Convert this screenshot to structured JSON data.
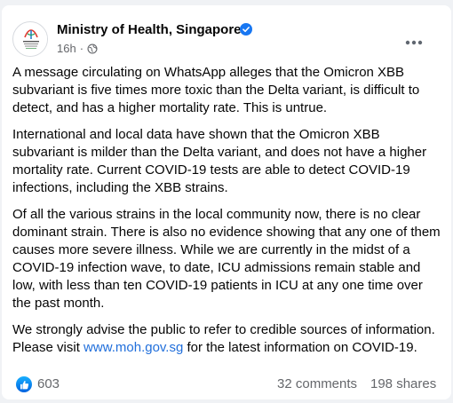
{
  "post": {
    "page_name": "Ministry of Health, Singapore",
    "time": "16h",
    "audience_icon": "globe-icon",
    "verified_icon": "verified-badge-icon",
    "more_icon": "more-options-icon",
    "avatar_text": "MINISTRY OF HEALTH",
    "paragraphs": [
      "A message circulating on WhatsApp alleges that the Omicron XBB subvariant is five times more toxic than the Delta variant, is difficult to detect, and has a higher mortality rate. This is untrue.",
      "International and local data have shown that the Omicron XBB subvariant is milder than the Delta variant, and does not have a higher mortality rate. Current COVID-19 tests are able to detect COVID-19 infections, including the XBB strains.",
      "Of all the various strains in the local community now, there is no clear dominant strain. There is also no evidence showing that any one of them causes more severe illness. While we are currently in the midst of a COVID-19 infection wave, to date, ICU admissions remain stable and low, with less than ten COVID-19 patients in ICU at any one time over the past month."
    ],
    "last_paragraph": {
      "before": "We strongly advise the public to refer to credible sources of information. Please visit ",
      "link": "www.moh.gov.sg",
      "after": " for the latest information on COVID-19."
    }
  },
  "stats": {
    "reactions": "603",
    "comments": "32 comments",
    "shares": "198 shares",
    "reaction_icon": "like-icon"
  },
  "colors": {
    "link": "#216fdb",
    "verified": "#1877f2",
    "secondary_text": "#65676b"
  }
}
